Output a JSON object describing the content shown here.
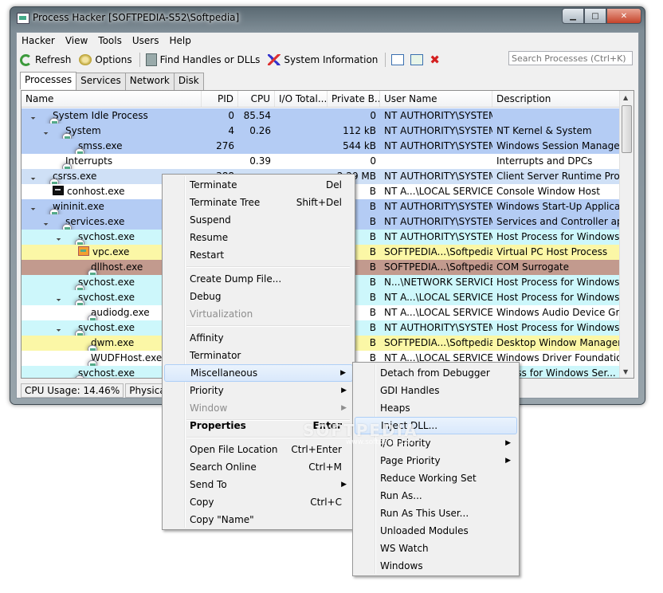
{
  "window": {
    "title": "Process Hacker [SOFTPEDIA-S52\\Softpedia]",
    "minimize": "▁",
    "maximize": "□",
    "close": "✕"
  },
  "menubar": [
    "Hacker",
    "View",
    "Tools",
    "Users",
    "Help"
  ],
  "toolbar": {
    "refresh": "Refresh",
    "options": "Options",
    "find_handles": "Find Handles or DLLs",
    "system_information": "System Information",
    "close_glyph": "✖",
    "search_placeholder": "Search Processes (Ctrl+K)"
  },
  "tabs": [
    "Processes",
    "Services",
    "Network",
    "Disk"
  ],
  "columns": [
    "Name",
    "PID",
    "CPU",
    "I/O Total...",
    "Private B...",
    "User Name",
    "Description"
  ],
  "rows": [
    {
      "name": "System Idle Process",
      "pid": "0",
      "cpu": "85.54",
      "io": "",
      "priv": "0",
      "user": "NT AUTHORITY\\SYSTEM",
      "desc": "",
      "bg": "#b4ccf4"
    },
    {
      "name": "System",
      "pid": "4",
      "cpu": "0.26",
      "io": "",
      "priv": "112 kB",
      "user": "NT AUTHORITY\\SYSTEM",
      "desc": "NT Kernel & System",
      "bg": "#b4ccf4"
    },
    {
      "name": "smss.exe",
      "pid": "276",
      "cpu": "",
      "io": "",
      "priv": "544 kB",
      "user": "NT AUTHORITY\\SYSTEM",
      "desc": "Windows Session Manager",
      "bg": "#b4ccf4"
    },
    {
      "name": "Interrupts",
      "pid": "",
      "cpu": "0.39",
      "io": "",
      "priv": "0",
      "user": "",
      "desc": "Interrupts and DPCs",
      "bg": "#ffffff"
    },
    {
      "name": "csrss.exe",
      "pid": "388",
      "cpu": "",
      "io": "",
      "priv": "2.29 MB",
      "user": "NT AUTHORITY\\SYSTEM",
      "desc": "Client Server Runtime Process",
      "bg": "#cfe0f6"
    },
    {
      "name": "conhost.exe",
      "pid": "",
      "cpu": "",
      "io": "",
      "priv": "B",
      "user": "NT A...\\LOCAL SERVICE",
      "desc": "Console Window Host",
      "bg": "#ffffff"
    },
    {
      "name": "wininit.exe",
      "pid": "",
      "cpu": "",
      "io": "",
      "priv": "B",
      "user": "NT AUTHORITY\\SYSTEM",
      "desc": "Windows Start-Up Application",
      "bg": "#b4ccf4"
    },
    {
      "name": "services.exe",
      "pid": "",
      "cpu": "",
      "io": "",
      "priv": "B",
      "user": "NT AUTHORITY\\SYSTEM",
      "desc": "Services and Controller app",
      "bg": "#b4ccf4"
    },
    {
      "name": "svchost.exe",
      "pid": "",
      "cpu": "",
      "io": "",
      "priv": "B",
      "user": "NT AUTHORITY\\SYSTEM",
      "desc": "Host Process for Windows Ser...",
      "bg": "#cdf7fb"
    },
    {
      "name": "vpc.exe",
      "pid": "",
      "cpu": "",
      "io": "",
      "priv": "B",
      "user": "SOFTPEDIA...\\Softpedia",
      "desc": "Virtual PC Host Process",
      "bg": "#fbf7a6"
    },
    {
      "name": "dllhost.exe",
      "pid": "",
      "cpu": "",
      "io": "",
      "priv": "B",
      "user": "SOFTPEDIA...\\Softpedia",
      "desc": "COM Surrogate",
      "bg": "#c29a8e"
    },
    {
      "name": "svchost.exe",
      "pid": "",
      "cpu": "",
      "io": "",
      "priv": "B",
      "user": "N...\\NETWORK SERVICE",
      "desc": "Host Process for Windows Ser...",
      "bg": "#cdf7fb"
    },
    {
      "name": "svchost.exe",
      "pid": "",
      "cpu": "",
      "io": "",
      "priv": "B",
      "user": "NT A...\\LOCAL SERVICE",
      "desc": "Host Process for Windows Ser...",
      "bg": "#cdf7fb"
    },
    {
      "name": "audiodg.exe",
      "pid": "",
      "cpu": "",
      "io": "",
      "priv": "B",
      "user": "NT A...\\LOCAL SERVICE",
      "desc": "Windows Audio Device Graph...",
      "bg": "#ffffff"
    },
    {
      "name": "svchost.exe",
      "pid": "",
      "cpu": "",
      "io": "",
      "priv": "B",
      "user": "NT AUTHORITY\\SYSTEM",
      "desc": "Host Process for Windows Ser...",
      "bg": "#cdf7fb"
    },
    {
      "name": "dwm.exe",
      "pid": "",
      "cpu": "",
      "io": "",
      "priv": "B",
      "user": "SOFTPEDIA...\\Softpedia",
      "desc": "Desktop Window Manager",
      "bg": "#fbf7a6"
    },
    {
      "name": "WUDFHost.exe",
      "pid": "",
      "cpu": "",
      "io": "",
      "priv": "B",
      "user": "NT A...\\LOCAL SERVICE",
      "desc": "Windows Driver Foundation - ...",
      "bg": "#ffffff"
    },
    {
      "name": "svchost.exe",
      "pid": "",
      "cpu": "",
      "io": "",
      "priv": "",
      "user": "",
      "desc": "...cess for Windows Ser...",
      "bg": "#cdf7fb"
    }
  ],
  "status": {
    "cpu": "CPU Usage: 14.46%",
    "mem": "Physical Mem"
  },
  "context_menu": {
    "terminate": {
      "label": "Terminate",
      "shortcut": "Del"
    },
    "terminate_tree": {
      "label": "Terminate Tree",
      "shortcut": "Shift+Del"
    },
    "suspend": {
      "label": "Suspend"
    },
    "resume": {
      "label": "Resume"
    },
    "restart": {
      "label": "Restart"
    },
    "dump": {
      "label": "Create Dump File..."
    },
    "debug": {
      "label": "Debug"
    },
    "virtualization": {
      "label": "Virtualization"
    },
    "affinity": {
      "label": "Affinity"
    },
    "terminator": {
      "label": "Terminator"
    },
    "misc": {
      "label": "Miscellaneous"
    },
    "priority": {
      "label": "Priority"
    },
    "window": {
      "label": "Window"
    },
    "properties": {
      "label": "Properties",
      "shortcut": "Enter"
    },
    "open_location": {
      "label": "Open File Location",
      "shortcut": "Ctrl+Enter"
    },
    "search_online": {
      "label": "Search Online",
      "shortcut": "Ctrl+M"
    },
    "send_to": {
      "label": "Send To"
    },
    "copy": {
      "label": "Copy",
      "shortcut": "Ctrl+C"
    },
    "copy_name": {
      "label": "Copy \"Name\""
    }
  },
  "submenu": {
    "detach": "Detach from Debugger",
    "gdi": "GDI Handles",
    "heaps": "Heaps",
    "inject": "Inject DLL...",
    "io_priority": "I/O Priority",
    "page_priority": "Page Priority",
    "reduce_ws": "Reduce Working Set",
    "run_as": "Run As...",
    "run_as_this_user": "Run As This User...",
    "unloaded_modules": "Unloaded Modules",
    "ws_watch": "WS Watch",
    "windows": "Windows"
  },
  "submenu_arrow": "▶",
  "watermark": "SOFTPEDIA",
  "watermark_url": "www.softpedia.com"
}
